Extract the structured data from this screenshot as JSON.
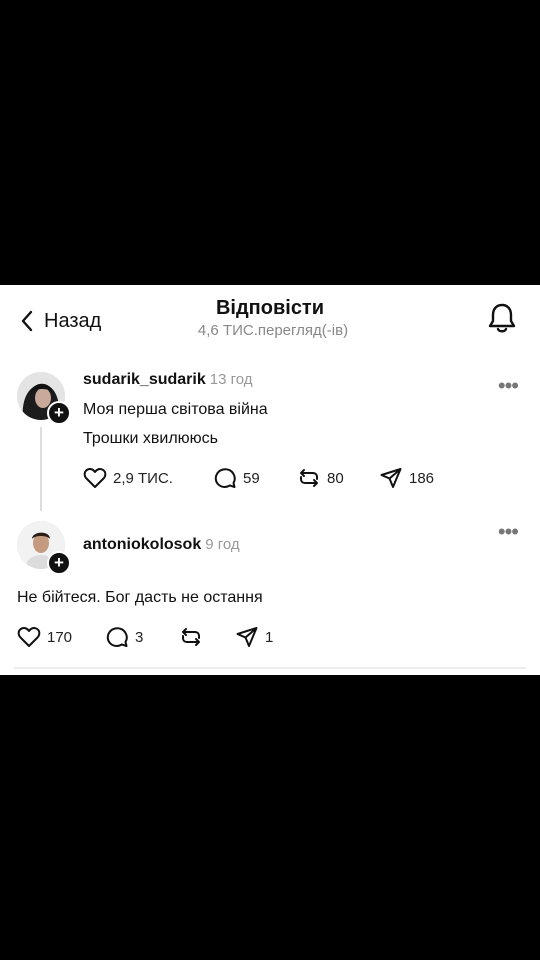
{
  "header": {
    "back_label": "Назад",
    "title": "Відповісти",
    "views": "4,6 ТИС.перегляд(-ів)"
  },
  "posts": [
    {
      "username": "sudarik_sudarik",
      "time": "13 год",
      "lines": [
        "Моя перша світова війна",
        "Трошки хвилююсь"
      ],
      "likes": "2,9 ТИС.",
      "comments": "59",
      "reposts": "80",
      "shares": "186"
    },
    {
      "username": "antoniokolosok",
      "time": "9 год",
      "lines": [
        "Не бійтеся. Бог дасть не остання"
      ],
      "likes": "170",
      "comments": "3",
      "reposts": "",
      "shares": "1"
    }
  ],
  "icons": {
    "back": "chevron-left-icon",
    "bell": "bell-icon",
    "like": "heart-icon",
    "comment": "comment-icon",
    "repost": "repost-icon",
    "share": "send-icon",
    "more": "more-icon"
  }
}
